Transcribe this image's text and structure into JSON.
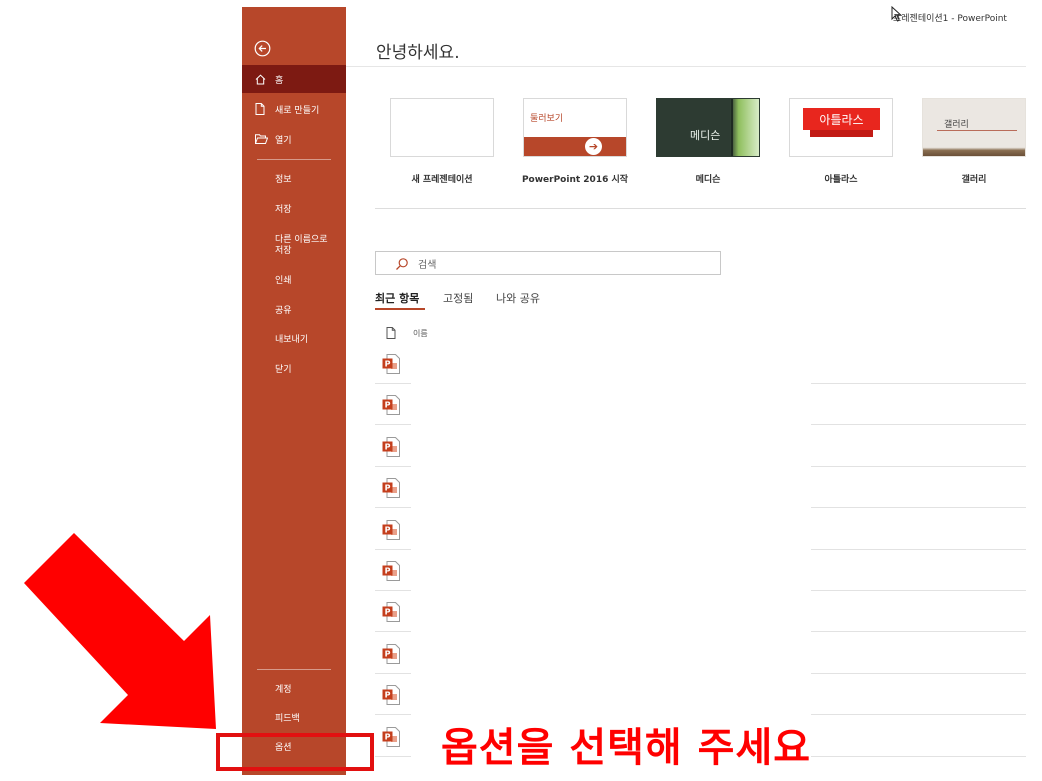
{
  "window": {
    "title": "프레젠테이션1  -  PowerPoint"
  },
  "greeting": "안녕하세요.",
  "sidebar": {
    "top_items": [
      {
        "label": "홈",
        "icon": "home-icon",
        "active": true
      },
      {
        "label": "새로 만들기",
        "icon": "new-document-icon"
      },
      {
        "label": "열기",
        "icon": "open-folder-icon"
      }
    ],
    "mid_items": [
      {
        "label": "정보"
      },
      {
        "label": "저장"
      },
      {
        "label": "다른 이름으로\n저장"
      },
      {
        "label": "인쇄"
      },
      {
        "label": "공유"
      },
      {
        "label": "내보내기"
      },
      {
        "label": "닫기"
      }
    ],
    "bottom_items": [
      {
        "label": "계정"
      },
      {
        "label": "피드백"
      },
      {
        "label": "옵션"
      }
    ]
  },
  "templates": [
    {
      "label": "새 프레젠테이션"
    },
    {
      "label": "PowerPoint 2016 시작",
      "thumb_text": "둘러보기"
    },
    {
      "label": "메디슨",
      "thumb_text": "메디슨"
    },
    {
      "label": "아틀라스",
      "thumb_text": "아틀라스"
    },
    {
      "label": "갤러리",
      "thumb_text": "갤러리"
    }
  ],
  "search": {
    "placeholder": "검색"
  },
  "tabs": [
    {
      "label": "최근 항목",
      "active": true
    },
    {
      "label": "고정됨"
    },
    {
      "label": "나와 공유"
    }
  ],
  "file_list": {
    "column_name": "이름",
    "row_count": 10
  },
  "annotation": {
    "callout": "옵션을 선택해 주세요",
    "color": "#ff0000"
  },
  "colors": {
    "accent": "#b7472a",
    "active": "#7d1a12"
  }
}
